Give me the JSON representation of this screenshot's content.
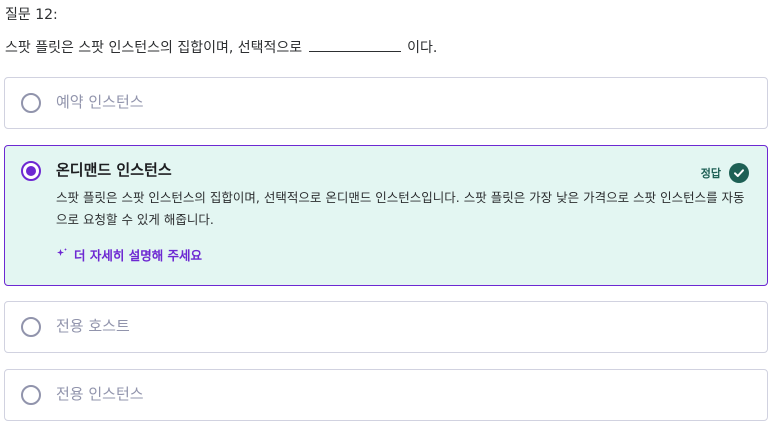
{
  "question": {
    "number_label": "질문 12:",
    "text_before": "스팟 플릿은 스팟 인스턴스의 집합이며, 선택적으로",
    "text_after": "이다."
  },
  "options": [
    {
      "label": "예약 인스턴스",
      "selected": false
    },
    {
      "label": "온디맨드 인스턴스",
      "selected": true
    },
    {
      "label": "전용 호스트",
      "selected": false
    },
    {
      "label": "전용 인스턴스",
      "selected": false
    }
  ],
  "result": {
    "correct_label": "정답",
    "explanation": "스팟 플릿은 스팟 인스턴스의 집합이며, 선택적으로 온디맨드 인스턴스입니다. 스팟 플릿은 가장 낮은 가격으로 스팟 인스턴스를 자동으로 요청할 수 있게 해줍니다.",
    "explain_more_label": "더 자세히 설명해 주세요"
  },
  "colors": {
    "accent": "#6d28d2",
    "correct_bg": "#e3f6f2",
    "correct_green": "#1e6055",
    "border": "#d1d2e0",
    "muted": "#9194ac"
  },
  "icons": {
    "check": "check-circle-icon",
    "sparkle": "sparkle-icon"
  }
}
